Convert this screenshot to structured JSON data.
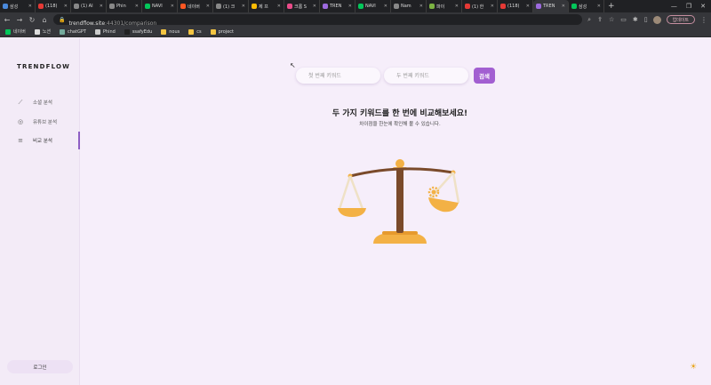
{
  "browser": {
    "tabs": [
      {
        "title": "삼성",
        "color": "#4a89dc"
      },
      {
        "title": "(118)",
        "color": "#e53935"
      },
      {
        "title": "(1) AI",
        "color": "#888888"
      },
      {
        "title": "Phin",
        "color": "#888888"
      },
      {
        "title": "NAVI",
        "color": "#03c75a"
      },
      {
        "title": "네이버",
        "color": "#ff5722"
      },
      {
        "title": "(1) 크",
        "color": "#888888"
      },
      {
        "title": "제 프",
        "color": "#fbbc04"
      },
      {
        "title": "크롬 S",
        "color": "#ea4c89"
      },
      {
        "title": "TREN",
        "color": "#9c6ade"
      },
      {
        "title": "NAVI",
        "color": "#03c75a"
      },
      {
        "title": "Nam",
        "color": "#888888"
      },
      {
        "title": "파이",
        "color": "#7cb342"
      },
      {
        "title": "(1) 한",
        "color": "#e53935"
      },
      {
        "title": "(118)",
        "color": "#e53935"
      },
      {
        "title": "TREN",
        "color": "#9c6ade"
      },
      {
        "title": "삼성",
        "color": "#03c75a"
      }
    ],
    "new_tab": "+",
    "url_host": "trendflow.site",
    "url_path": ":44301/comparison",
    "update_label": "업데이트",
    "bookmarks": [
      {
        "label": "네이버",
        "color": "#03c75a"
      },
      {
        "label": "노션",
        "color": "#dddddd"
      },
      {
        "label": "chatGPT",
        "color": "#74aa9c"
      },
      {
        "label": "Phind",
        "color": "#cccccc"
      },
      {
        "label": "ssafyEdu",
        "color": "#222222"
      },
      {
        "label": "nous",
        "color": "#f4c542"
      },
      {
        "label": "cs",
        "color": "#f4c542"
      },
      {
        "label": "project",
        "color": "#f4c542"
      }
    ]
  },
  "app": {
    "logo": "TRENDFLOW",
    "menu": [
      {
        "icon": "chart-line-icon",
        "glyph": "⟋",
        "label": "소셜 분석"
      },
      {
        "icon": "play-circle-icon",
        "glyph": "◎",
        "label": "유튜브 분석"
      },
      {
        "icon": "sliders-icon",
        "glyph": "≡",
        "label": "비교 분석"
      }
    ],
    "login_label": "로그인",
    "keyword1_placeholder": "첫 번째 키워드",
    "keyword2_placeholder": "두 번째 키워드",
    "search_label": "검색",
    "headline": "두 가지 키워드를 한 번에 비교해보세요!",
    "subline": "차이점을 한눈에 확인해 볼 수 있습니다.",
    "accent_color": "#a25fd1",
    "theme_icon": "☀"
  }
}
